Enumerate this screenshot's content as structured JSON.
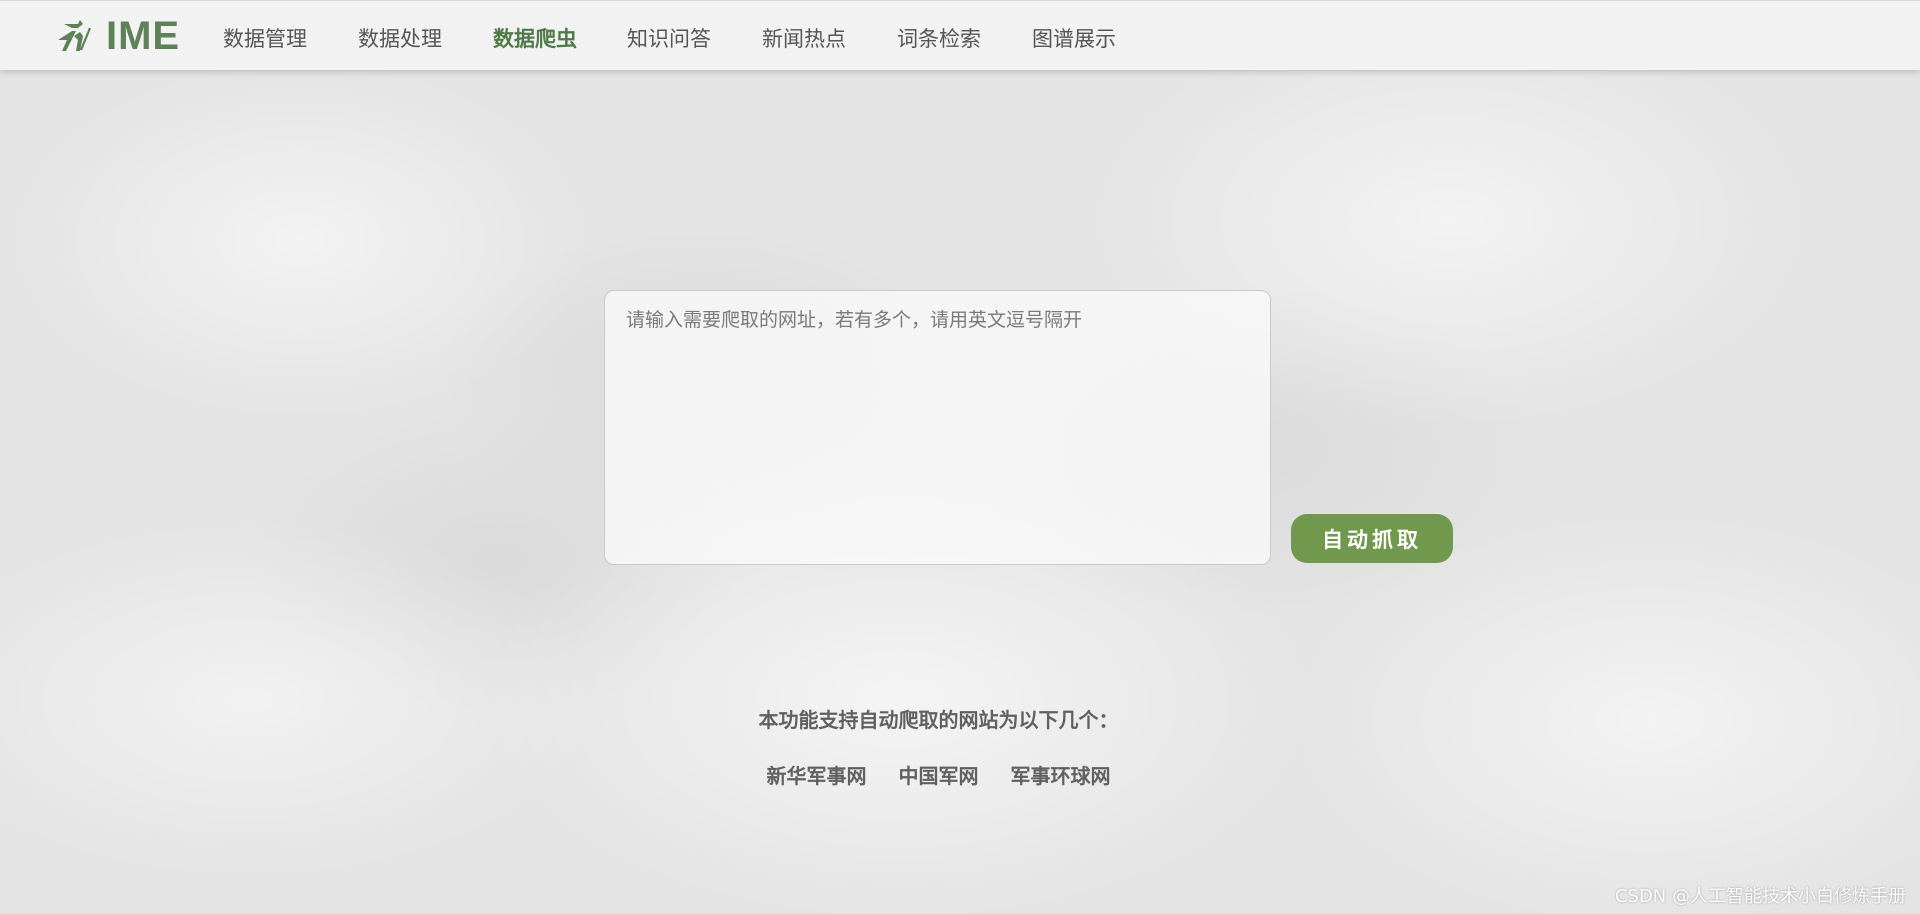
{
  "brand": {
    "name": "IME",
    "icon": "runner-logo-icon",
    "color": "#5e8157"
  },
  "nav": {
    "items": [
      {
        "label": "数据管理"
      },
      {
        "label": "数据处理"
      },
      {
        "label": "数据爬虫",
        "active": true
      },
      {
        "label": "知识问答"
      },
      {
        "label": "新闻热点"
      },
      {
        "label": "词条检索"
      },
      {
        "label": "图谱展示"
      }
    ]
  },
  "crawler": {
    "input_value": "",
    "input_placeholder": "请输入需要爬取的网址，若有多个，请用英文逗号隔开",
    "button_label": "自动抓取",
    "button_color": "#71994e"
  },
  "support": {
    "title": "本功能支持自动爬取的网站为以下几个：",
    "sites": [
      "新华军事网",
      "中国军网",
      "军事环球网"
    ]
  },
  "watermark": "CSDN @人工智能技术小白修炼手册"
}
